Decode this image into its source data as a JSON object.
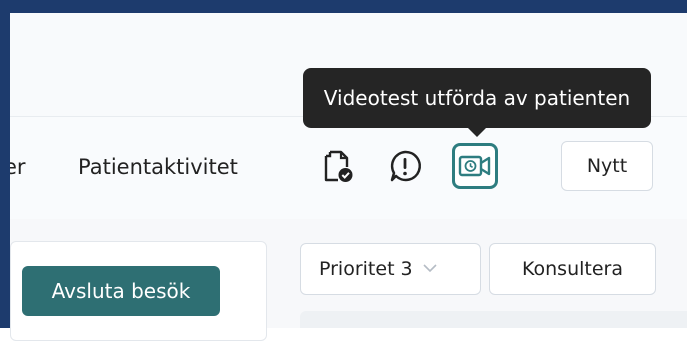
{
  "nav": {
    "partial_tab_label": "er",
    "patient_activity_label": "Patientaktivitet",
    "icons": {
      "document": "document-check-icon",
      "alert": "exclamation-circle-icon",
      "video": "video-camera-icon"
    },
    "new_button_label": "Nytt"
  },
  "tooltip": {
    "text": "Videotest utförda av patienten"
  },
  "actions": {
    "end_visit_label": "Avsluta besök",
    "priority_select_value": "Prioritet 3",
    "consult_label": "Konsultera"
  },
  "colors": {
    "accent": "#2e7d80",
    "primary_button": "#2e6f73",
    "tooltip_bg": "#252525",
    "window_border": "#1d3b6d"
  }
}
